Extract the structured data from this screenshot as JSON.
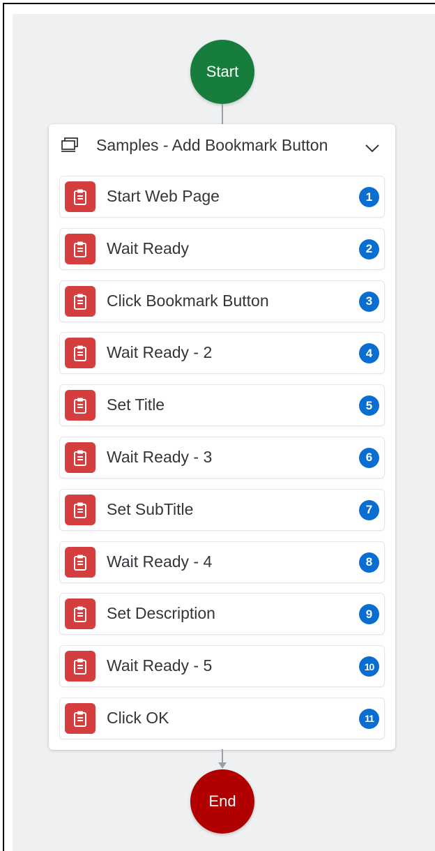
{
  "flow": {
    "start_label": "Start",
    "end_label": "End",
    "group": {
      "title": "Samples - Add Bookmark Button",
      "icon": "desktop-screen-icon",
      "expand_icon": "chevron-down-icon"
    },
    "steps": [
      {
        "label": "Start Web Page",
        "number": "1"
      },
      {
        "label": "Wait Ready",
        "number": "2"
      },
      {
        "label": "Click Bookmark Button",
        "number": "3"
      },
      {
        "label": "Wait Ready - 2",
        "number": "4"
      },
      {
        "label": "Set Title",
        "number": "5"
      },
      {
        "label": "Wait Ready - 3",
        "number": "6"
      },
      {
        "label": "Set SubTitle",
        "number": "7"
      },
      {
        "label": "Wait Ready - 4",
        "number": "8"
      },
      {
        "label": "Set Description",
        "number": "9"
      },
      {
        "label": "Wait Ready - 5",
        "number": "10"
      },
      {
        "label": "Click OK",
        "number": "11"
      }
    ],
    "step_icon": "clipboard-icon"
  },
  "colors": {
    "start": "#167d3c",
    "end": "#b00000",
    "step_icon_bg": "#d43e3e",
    "badge": "#0a6ed1",
    "canvas": "#eef0f2"
  }
}
